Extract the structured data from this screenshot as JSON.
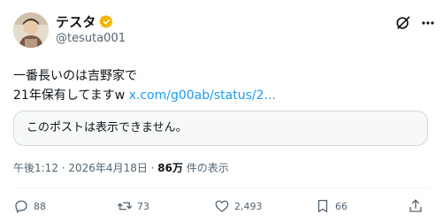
{
  "author": {
    "display_name": "テスタ",
    "handle": "@tesuta001",
    "verified_color": "#f4b400"
  },
  "header_icons": [
    "grok-icon",
    "more-options-icon"
  ],
  "body": {
    "line1": "一番長いのは吉野家で",
    "line2_text": "21年保有してますw ",
    "line2_link": "x.com/g00ab/status/2..."
  },
  "quote": {
    "text": "このポストは表示できません。"
  },
  "meta": {
    "timestamp": "午後1:12 · 2026年4月18日 · ",
    "views": "86万",
    "views_suffix": " 件の表示"
  },
  "actions": {
    "replies": "88",
    "reposts": "73",
    "likes": "2,493",
    "bookmarks": "66"
  },
  "colors": {
    "link": "#1d9bf0",
    "secondary_text": "#536471",
    "border": "#cfd9de"
  }
}
